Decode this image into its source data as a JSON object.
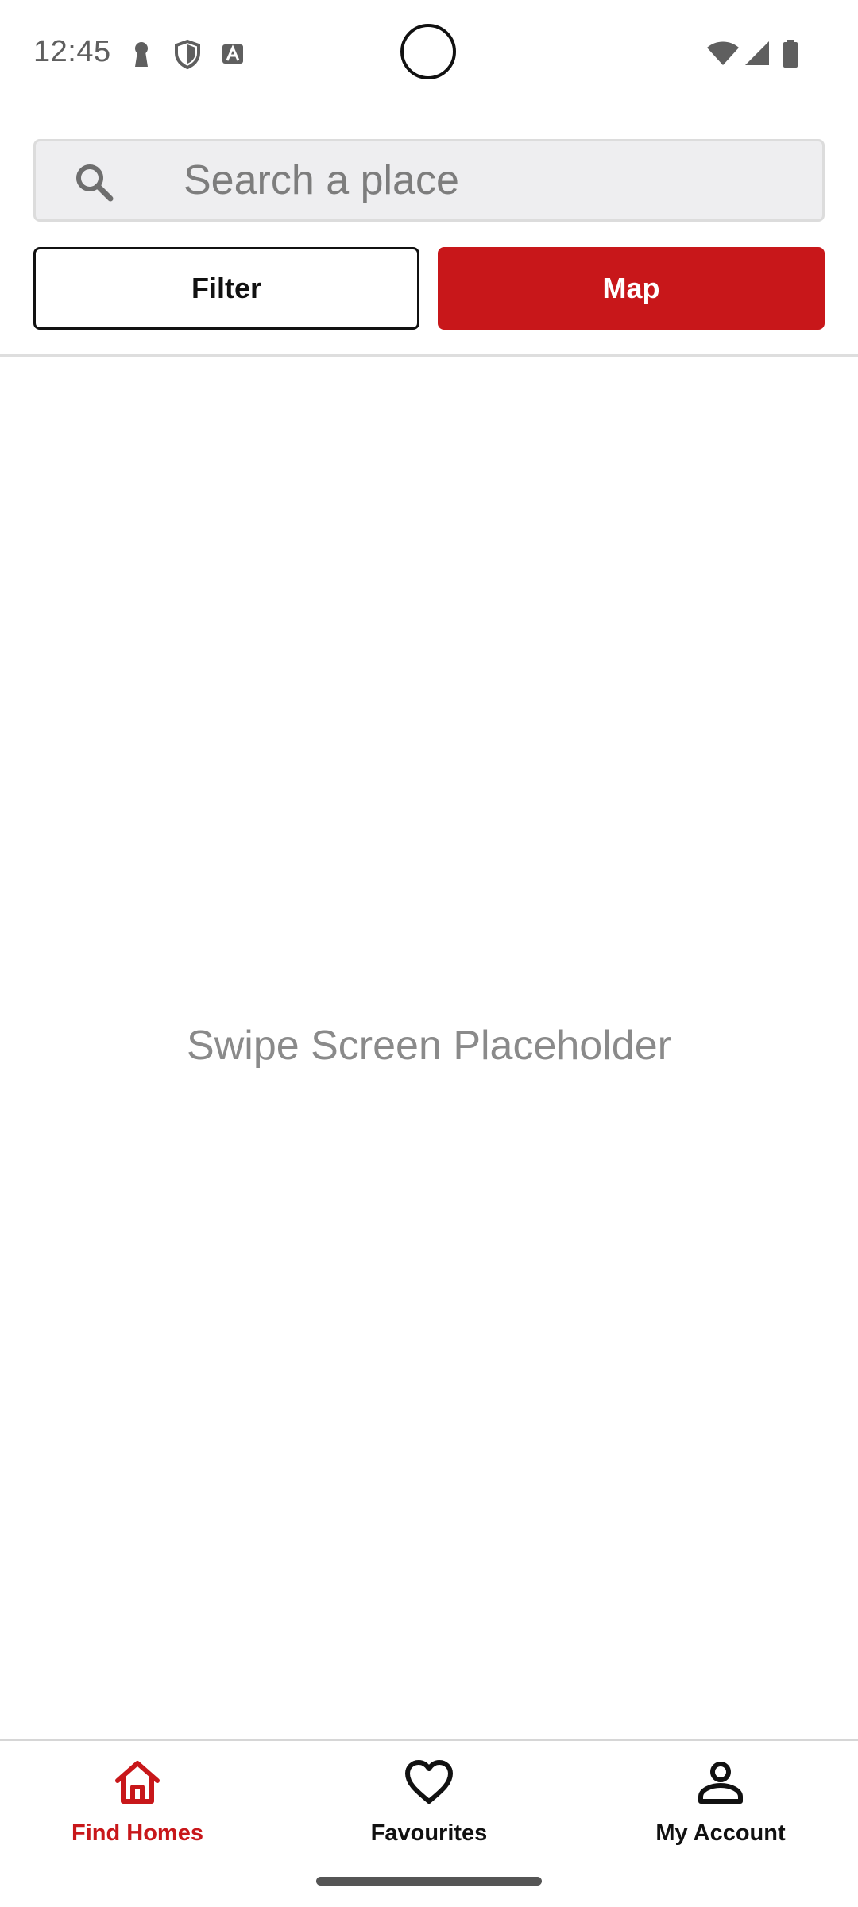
{
  "status_bar": {
    "time": "12:45",
    "icons_left": [
      "keyhole-icon",
      "shield-icon",
      "text-a-icon"
    ],
    "icons_right": [
      "wifi-icon",
      "signal-icon",
      "battery-icon"
    ]
  },
  "search": {
    "placeholder": "Search a place",
    "value": "",
    "icon": "search-icon"
  },
  "actions": {
    "filter_label": "Filter",
    "map_label": "Map"
  },
  "content": {
    "placeholder": "Swipe Screen Placeholder"
  },
  "bottom_nav": {
    "items": [
      {
        "label": "Find Homes",
        "icon": "home-icon",
        "active": true
      },
      {
        "label": "Favourites",
        "icon": "heart-icon",
        "active": false
      },
      {
        "label": "My Account",
        "icon": "person-icon",
        "active": false
      }
    ]
  },
  "colors": {
    "accent": "#c8171a",
    "search_bg": "#eeeef0",
    "text_muted": "#8a8a8a"
  }
}
